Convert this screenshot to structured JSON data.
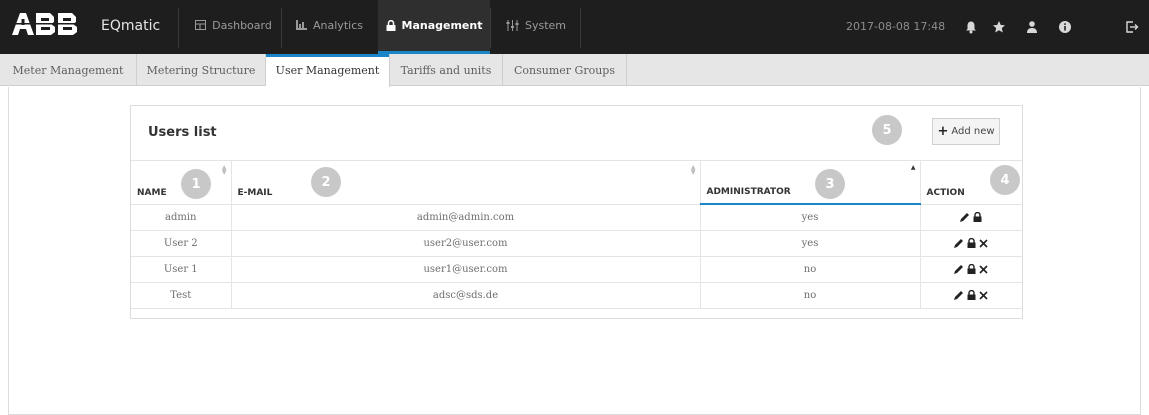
{
  "header": {
    "app_name": "EQmatic",
    "nav": [
      {
        "label": "Dashboard",
        "icon": "dashboard-icon"
      },
      {
        "label": "Analytics",
        "icon": "analytics-icon"
      },
      {
        "label": "Management",
        "icon": "lock-icon",
        "active": true
      },
      {
        "label": "System",
        "icon": "system-icon"
      }
    ],
    "datetime": "2017-08-08 17:48",
    "toolbar_icons": [
      "bell-icon",
      "star-icon",
      "user-icon",
      "info-icon",
      "logout-icon"
    ]
  },
  "subnav": {
    "tabs": [
      "Meter Management",
      "Metering Structure",
      "User Management",
      "Tariffs and units",
      "Consumer Groups"
    ],
    "active": "User Management"
  },
  "users_panel": {
    "title": "Users list",
    "add_label": "Add new",
    "columns": [
      "NAME",
      "E-MAIL",
      "ADMINISTRATOR",
      "ACTION"
    ],
    "rows": [
      {
        "name": "admin",
        "email": "admin@admin.com",
        "admin": "yes"
      },
      {
        "name": "User 2",
        "email": "user2@user.com",
        "admin": "yes"
      },
      {
        "name": "User 1",
        "email": "user1@user.com",
        "admin": "no"
      },
      {
        "name": "Test",
        "email": "adsc@sds.de",
        "admin": "no"
      }
    ]
  },
  "badges": [
    "1",
    "2",
    "3",
    "4",
    "5"
  ],
  "colors": {
    "accent": "#1a86c7",
    "topbar": "#1e1e1e",
    "badge": "#c8c8c8"
  }
}
